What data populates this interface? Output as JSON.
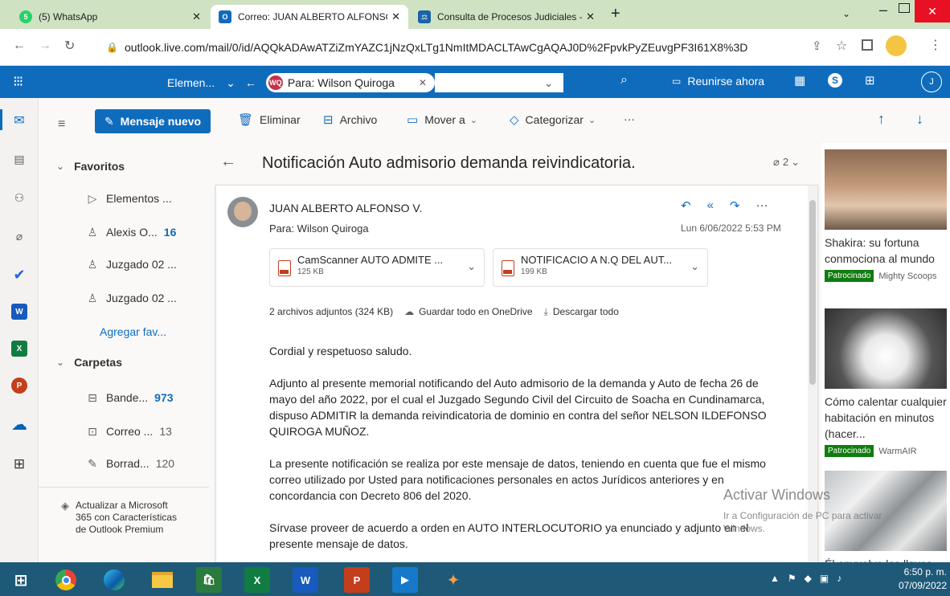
{
  "browser": {
    "tabs": [
      {
        "label": "(5) WhatsApp",
        "icon": "whatsapp-icon",
        "active": false
      },
      {
        "label": "Correo: JUAN ALBERTO ALFONSO",
        "icon": "outlook-icon",
        "active": true
      },
      {
        "label": "Consulta de Procesos Judiciales -",
        "icon": "court-icon",
        "active": false
      }
    ],
    "url": "outlook.live.com/mail/0/id/AQQkADAwATZiZmYAZC1jNzQxLTg1NmItMDACLTAwCgAQAJ0D%2FpvkPyZEuvgPF3I61X8%3D"
  },
  "outlook_header": {
    "search_scope": "Elemen...",
    "search_chip_initials": "WQ",
    "search_chip_label": "Para: Wilson Quiroga",
    "meet_now": "Reunirse ahora",
    "avatar_initial": "J"
  },
  "command_bar": {
    "new_message": "Mensaje nuevo",
    "delete": "Eliminar",
    "archive": "Archivo",
    "move_to": "Mover a",
    "categorize": "Categorizar",
    "more": "···"
  },
  "nav": {
    "favorites_header": "Favoritos",
    "favorites": [
      {
        "label": "Elementos ...",
        "icon": "send-icon",
        "count": ""
      },
      {
        "label": "Alexis O...",
        "icon": "person-icon",
        "count": "16"
      },
      {
        "label": "Juzgado 02 ...",
        "icon": "person-icon",
        "count": ""
      },
      {
        "label": "Juzgado 02 ...",
        "icon": "person-icon",
        "count": ""
      }
    ],
    "add_favorite": "Agregar fav...",
    "folders_header": "Carpetas",
    "folders": [
      {
        "label": "Bande...",
        "icon": "inbox-icon",
        "count": "973",
        "bold": true
      },
      {
        "label": "Correo ...",
        "icon": "junk-icon",
        "count": "13",
        "bold": false
      },
      {
        "label": "Borrad...",
        "icon": "draft-icon",
        "count": "120",
        "bold": false
      }
    ],
    "upgrade_text": "Actualizar a Microsoft 365 con Características de Outlook Premium"
  },
  "message": {
    "subject": "Notificación Auto admisorio demanda reivindicatoria.",
    "attachment_count": "2",
    "sender": "JUAN ALBERTO ALFONSO V.",
    "to": "Para: Wilson Quiroga",
    "date": "Lun 6/06/2022 5:53 PM",
    "attachments": [
      {
        "name": "CamScanner AUTO ADMITE ...",
        "size": "125 KB"
      },
      {
        "name": "NOTIFICACIO A N.Q DEL AUT...",
        "size": "199 KB"
      }
    ],
    "attachments_summary": "2 archivos adjuntos (324 KB)",
    "save_onedrive": "Guardar todo en OneDrive",
    "download_all": "Descargar todo",
    "body": [
      "Cordial y respetuoso saludo.",
      "Adjunto al presente memorial notificando del Auto admisorio de la demanda y Auto de fecha 26 de mayo del año 2022, por el cual el Juzgado Segundo Civil del Circuito de Soacha en Cundinamarca, dispuso ADMITIR la demanda reivindicatoria de dominio en contra del señor NELSON ILDEFONSO QUIROGA MUÑOZ.",
      "La presente notificación se realiza por este mensaje de datos, teniendo en cuenta que fue el mismo correo utilizado por Usted para notificaciones personales en actos Jurídicos anteriores y en concordancia con Decreto 806 del 2020.",
      "Sírvase proveer de acuerdo a orden en AUTO INTERLOCUTORIO ya enunciado y adjunto en el presente mensaje de datos."
    ]
  },
  "ads": [
    {
      "text": "Shakira: su fortuna conmociona al mundo",
      "sponsor_tag": "Patrocinado",
      "sponsor": "Mighty Scoops"
    },
    {
      "text": "Cómo calentar cualquier habitación en minutos (hacer...",
      "sponsor_tag": "Patrocinado",
      "sponsor": "WarmAIR"
    },
    {
      "text": "Él envuelve las llaves",
      "sponsor_tag": "",
      "sponsor": ""
    }
  ],
  "watermark": {
    "title": "Activar Windows",
    "subtitle": "Ir a Configuración de PC para activar Windows."
  },
  "taskbar": {
    "time": "6:50 p. m.",
    "date": "07/09/2022"
  }
}
